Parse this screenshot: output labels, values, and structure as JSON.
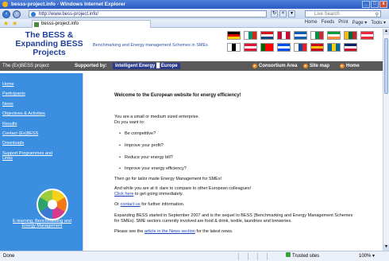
{
  "window": {
    "title": "besss-project.info - Windows Internet Explorer",
    "controls": [
      "_",
      "□",
      "x"
    ]
  },
  "toolbar": {
    "url": "http://www.bess-project.info/",
    "search_placeholder": "Live Search",
    "tab_label": "besss-project.info",
    "ie_tools": [
      "Home",
      "Feeds",
      "Print",
      "Page ▾",
      "Tools ▾"
    ]
  },
  "header": {
    "logo": "The BESS & Expanding BESS Projects",
    "tagline": "Benchmarking and Energy management Schemes in SMEs"
  },
  "navbar": {
    "project_label": "The (Ex)BESS project",
    "supported_by": "Supported by:",
    "program_logo": "Intelligent Energy █ Europe",
    "links": [
      "Consortium Area",
      "Site map",
      "Home"
    ]
  },
  "sidebar": {
    "items": [
      "Home",
      "Participants",
      "News",
      "Objectives & Activities",
      "Results",
      "Contact (Ex)BESS",
      "Downloads",
      "Support Programmes and Links"
    ],
    "elearning_label": "E-learning, Benchmarking and Energy Management"
  },
  "content": {
    "welcome": "Welcome to the European website for energy efficiency!",
    "intro_line1": "You are a small or medium sized enterprise.",
    "intro_line2": "Do you want to:",
    "bullets": [
      "Be competitive?",
      "Improve your profit?",
      "Reduce your energy bill?",
      "Improve your energy efficiency?"
    ],
    "tailor": "Then go for tailor made Energy Management for SMEs!",
    "compare": "And while you are at it: dare to compare to other European colleagues!",
    "click_here": "Click here",
    "click_here_rest": " to get going immediately.",
    "or": "Or ",
    "contact_us": "contact us",
    "contact_rest": " for further information.",
    "expanding_1": "Expanding BESS started in September 2007 and is the sequel to BESS (Benchmarking and Energy Management Schemes",
    "expanding_2": "for SMEs). SME sectors currently involved are food & drink, textile, laundries and breweries.",
    "see_latest_pre": "Please see the ",
    "news_link": "article in the News section",
    "see_latest_post": " for the latest news."
  },
  "status": {
    "done": "Done",
    "trusted": "Trusted sites",
    "zoom": "100% ▾"
  },
  "colors": {
    "sidebar_bg": "#3c8fe0",
    "navbar_bg": "#5a5a5a",
    "logo_text": "#1f3f99",
    "link": "#1a3fb3"
  },
  "flags": [
    [
      "#000000",
      "#dd0000",
      "#ffce00"
    ],
    [
      "#ffffff",
      "#00966e",
      "#d62612"
    ],
    [
      "#d7141a",
      "#ffffff",
      "#11457e"
    ],
    [
      "#c60c30",
      "#ffffff",
      "#c60c30"
    ],
    [
      "#0d5eaf",
      "#ffffff",
      "#0d5eaf"
    ],
    [
      "#ffffff",
      "#009246",
      "#ce2b37"
    ],
    [
      "#009b3a",
      "#ffffff",
      "#ff883e"
    ],
    [
      "#fdb913",
      "#006a44",
      "#c1272d"
    ],
    [
      "#ed2939",
      "#ffffff",
      "#ed2939"
    ],
    [
      "#ffffff",
      "#000000",
      "#ffffff"
    ],
    [
      "#dc143c",
      "#ffffff",
      "#dc143c"
    ],
    [
      "#006600",
      "#ff0000",
      "#ff0000"
    ],
    [
      "#0050f0",
      "#ffffff",
      "#0050f0"
    ],
    [
      "#ffffff",
      "#0b4ea2",
      "#ee1c25"
    ],
    [
      "#c60b1e",
      "#ffc400",
      "#c60b1e"
    ],
    [
      "#006aa7",
      "#fecc00",
      "#006aa7"
    ],
    [
      "#012169",
      "#ffffff",
      "#c8102e"
    ]
  ]
}
